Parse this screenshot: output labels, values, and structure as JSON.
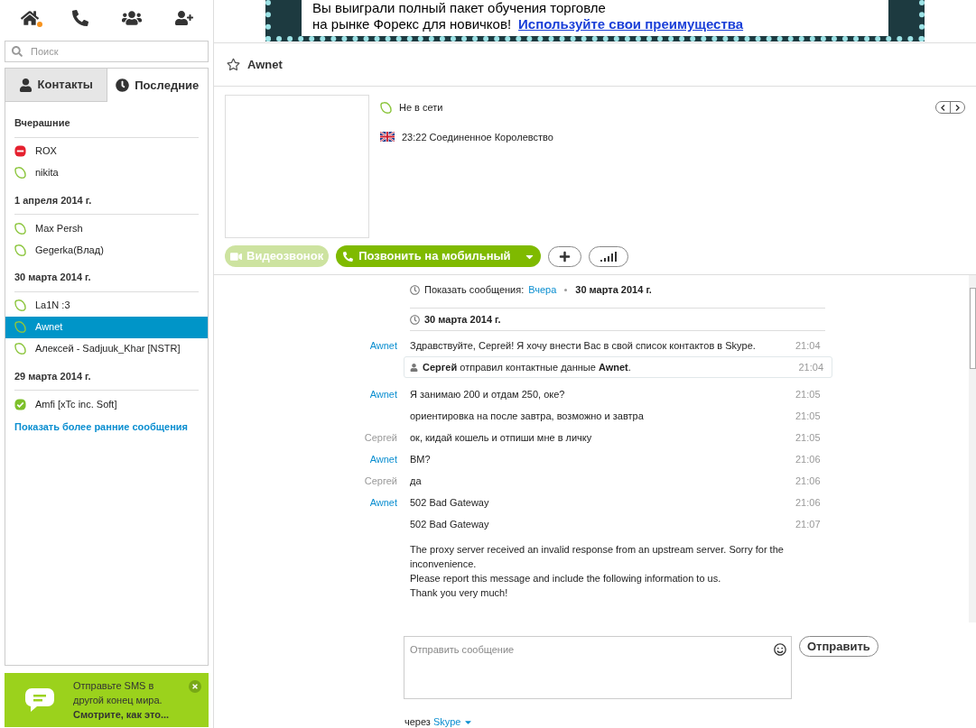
{
  "nav": {
    "notification": true
  },
  "search": {
    "placeholder": "Поиск"
  },
  "tabs": [
    {
      "label": "Контакты",
      "selected": false,
      "kind": "contacts"
    },
    {
      "label": "Последние",
      "selected": true,
      "kind": "recent"
    }
  ],
  "recent_groups": [
    {
      "title": "Вчерашние",
      "items": [
        {
          "name": "ROX",
          "kind": "dnd",
          "selected": false
        },
        {
          "name": "nikita",
          "kind": "offline",
          "selected": false
        }
      ]
    },
    {
      "title": "1 апреля 2014 г.",
      "items": [
        {
          "name": "Max Persh",
          "kind": "offline",
          "selected": false
        },
        {
          "name": "Gegerka(Влад)",
          "kind": "offline",
          "selected": false
        }
      ]
    },
    {
      "title": "30 марта 2014 г.",
      "items": [
        {
          "name": "La1N :3",
          "kind": "offline",
          "selected": false
        },
        {
          "name": "Awnet",
          "kind": "offline",
          "selected": true
        },
        {
          "name": "Алексей - Sadjuuk_Khar [NSTR]",
          "kind": "offline",
          "selected": false
        }
      ]
    },
    {
      "title": "29 марта 2014 г.",
      "items": [
        {
          "name": "Amfi [xTc inc. Soft]",
          "kind": "online",
          "selected": false
        }
      ]
    }
  ],
  "show_earlier": "Показать более ранние сообщения",
  "promo": {
    "lines": [
      "Отправьте SMS в",
      "другой конец мира."
    ],
    "link": "Смотрите, как это..."
  },
  "banner": {
    "lines": [
      "Вы выиграли полный пакет обучения торговле",
      "на рынке Форекс для новичков!"
    ],
    "link": "Используйте свои преимущества"
  },
  "contact": {
    "name": "Awnet",
    "favorite": false,
    "presence": {
      "kind": "offline",
      "label": "Не в сети"
    },
    "local_time": "23:22 Соединенное Королевство"
  },
  "actions": {
    "video": {
      "label": "Видеозвонок",
      "disabled": true
    },
    "call": {
      "label": "Позвонить на мобильный",
      "disabled": false
    }
  },
  "history": {
    "label": "Показать сообщения:",
    "link": "Вчера",
    "date": "30 марта 2014 г."
  },
  "date_header": "30 марта 2014 г.",
  "messages": [
    {
      "kind": "message",
      "sender": "Awnet",
      "outgoing": false,
      "text": "Здравствуйте, Сергей! Я хочу внести Вас в свой список контактов в Skype.",
      "time": "21:04"
    },
    {
      "kind": "system",
      "text": "**Сергей** отправил контактные данные **Awnet**.",
      "time": "21:04"
    },
    {
      "kind": "message",
      "sender": "Awnet",
      "outgoing": false,
      "text": "Я занимаю 200 и отдам 250, оке?",
      "time": "21:05"
    },
    {
      "kind": "message",
      "text": "ориентировка на после завтра, возможно и завтра",
      "time": "21:05"
    },
    {
      "kind": "message",
      "sender": "Сергей",
      "outgoing": true,
      "text": "ок, кидай кошель и отпиши  мне в личку",
      "time": "21:05"
    },
    {
      "kind": "message",
      "sender": "Awnet",
      "outgoing": false,
      "text": "BM?",
      "time": "21:06"
    },
    {
      "kind": "message",
      "sender": "Сергей",
      "outgoing": true,
      "text": "да",
      "time": "21:06"
    },
    {
      "kind": "message",
      "sender": "Awnet",
      "outgoing": false,
      "text": "502 Bad Gateway",
      "time": "21:06"
    },
    {
      "kind": "message",
      "text": "502 Bad Gateway",
      "time": "21:07"
    },
    {
      "kind": "note",
      "lines": [
        "The proxy server received an invalid response from an upstream server. Sorry for the inconvenience.",
        "Please report this message and include the following information to us.",
        "Thank you very much!"
      ]
    }
  ],
  "composer": {
    "placeholder": "Отправить сообщение",
    "send": "Отправить",
    "via": "через",
    "via_link": "Skype"
  }
}
